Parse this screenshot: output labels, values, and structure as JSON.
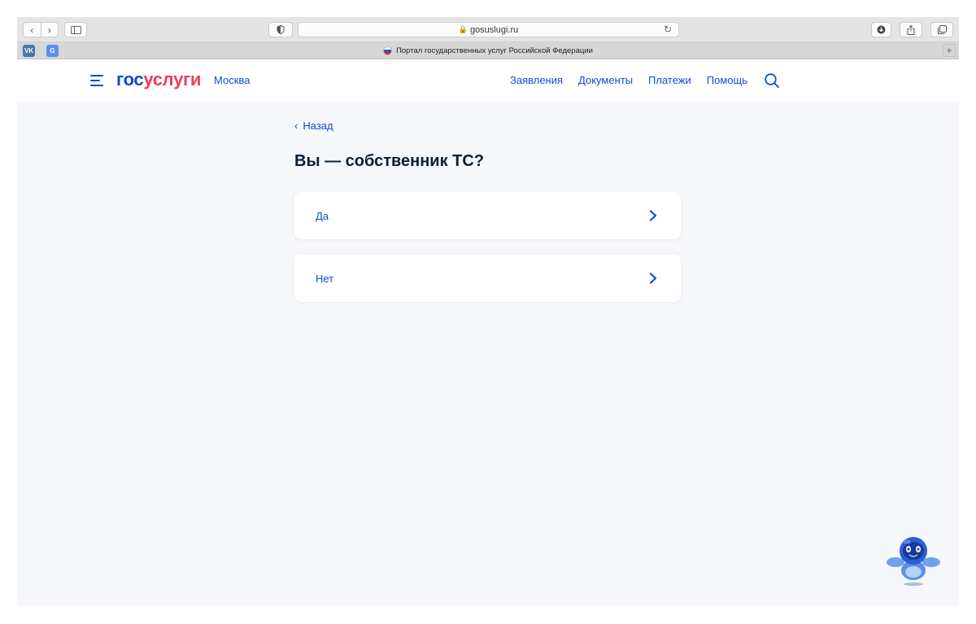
{
  "browser": {
    "url": "gosuslugi.ru",
    "tab_title": "Портал государственных услуг Российской Федерации",
    "new_tab_label": "+",
    "favicon_vk": "VK",
    "favicon_translate": "G"
  },
  "header": {
    "logo_part1": "гос",
    "logo_part2": "услуги",
    "city": "Москва",
    "nav": [
      "Заявления",
      "Документы",
      "Платежи",
      "Помощь"
    ]
  },
  "content": {
    "back_label": "Назад",
    "question": "Вы — собственник ТС?",
    "options": [
      "Да",
      "Нет"
    ]
  },
  "colors": {
    "brand_blue": "#0d4cd3",
    "brand_red": "#ee3f58",
    "page_bg": "#f5f7fa",
    "text_dark": "#0b1f33"
  },
  "icons": {
    "menu": "hamburger-menu-icon",
    "search": "search-icon",
    "option_arrow": "chevron-right-icon",
    "assistant": "robot-assistant-icon"
  }
}
